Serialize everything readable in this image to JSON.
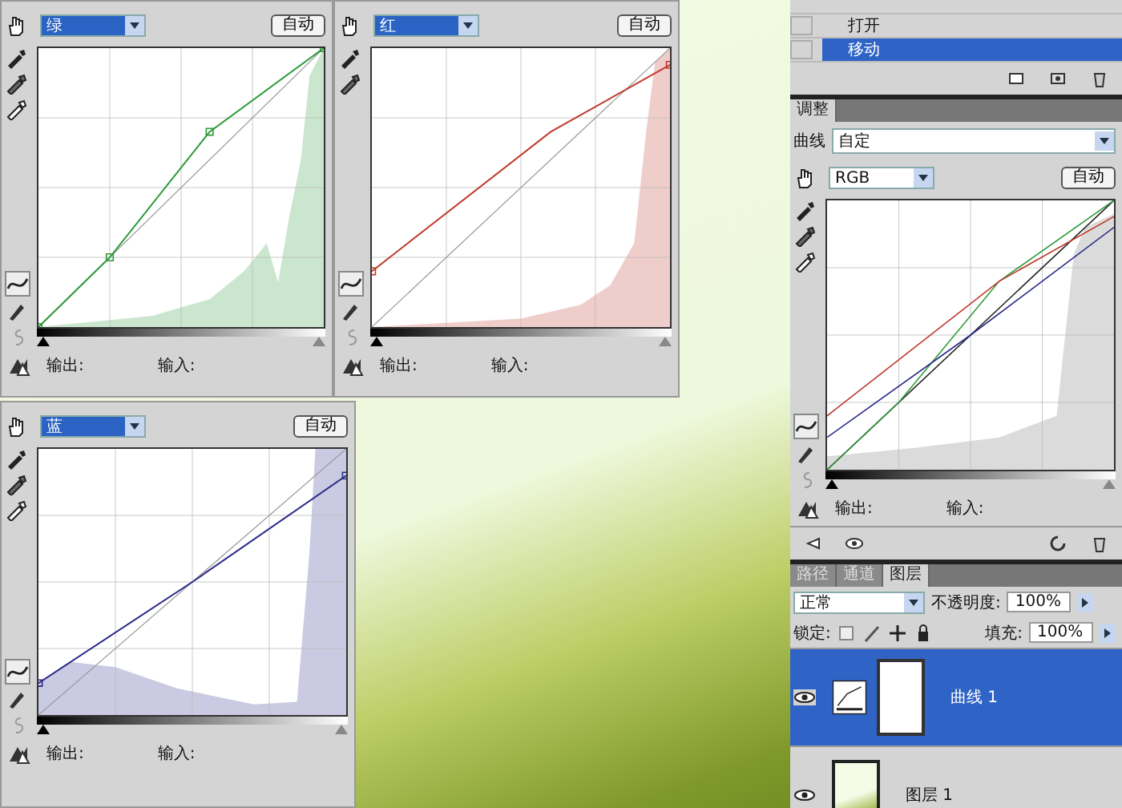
{
  "curves_panels": [
    {
      "channel": "绿",
      "auto_button": "自动",
      "output_label": "输出:",
      "input_label": "输入:",
      "color": "#2f9a3a",
      "sliders": [
        {
          "level": 0
        },
        {
          "level": 1
        }
      ]
    },
    {
      "channel": "红",
      "auto_button": "自动",
      "output_label": "输出:",
      "input_label": "输入:",
      "color": "#c0392b",
      "sliders": [
        {
          "level": 0
        },
        {
          "level": 1
        }
      ]
    },
    {
      "channel": "蓝",
      "auto_button": "自动",
      "output_label": "输出:",
      "input_label": "输入:",
      "color": "#2a2a8a",
      "sliders": [
        {
          "level": 0
        },
        {
          "level": 1
        }
      ]
    }
  ],
  "history": {
    "items": [
      {
        "label": "打开",
        "selected": false
      },
      {
        "label": "移动",
        "selected": true
      }
    ]
  },
  "adjustments": {
    "sliders": [
      {
        "level": 0
      },
      {
        "level": 1
      }
    ],
    "tab": "调整",
    "preset_label": "曲线",
    "preset": "自定",
    "channel": "RGB",
    "auto_button": "自动",
    "output_label": "输出:",
    "input_label": "输入:"
  },
  "layers_panel": {
    "tabs": [
      {
        "label": "路径",
        "selected": false
      },
      {
        "label": "通道",
        "selected": false
      },
      {
        "label": "图层",
        "selected": true
      }
    ],
    "blend_mode": "正常",
    "opacity_label": "不透明度:",
    "opacity": "100%",
    "lock_label": "锁定:",
    "fill_label": "填充:",
    "fill": "100%",
    "layers": [
      {
        "name": "曲线 1",
        "kind": "adjustment",
        "selected": true
      },
      {
        "name": "图层 1",
        "kind": "image",
        "selected": false
      }
    ]
  }
}
